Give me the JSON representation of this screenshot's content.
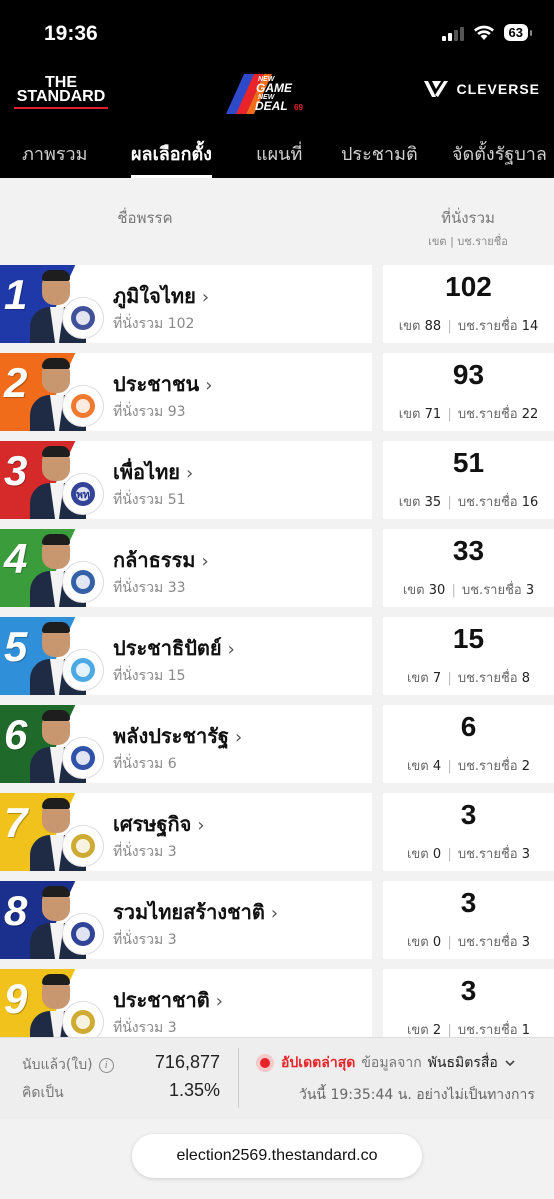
{
  "status_bar": {
    "time": "19:36",
    "battery": "63"
  },
  "header": {
    "logo_left": "THE STANDARD",
    "logo_game_lines": [
      "NEW",
      "GAME",
      "NEW",
      "DEAL",
      "69"
    ],
    "logo_right": "CLEVERSE"
  },
  "tabs": [
    {
      "label": "ภาพรวม",
      "active": false
    },
    {
      "label": "ผลเลือกตั้ง",
      "active": true
    },
    {
      "label": "แผนที่",
      "active": false
    },
    {
      "label": "ประชามติ",
      "active": false
    },
    {
      "label": "จัดตั้งรัฐบาล",
      "active": false
    }
  ],
  "columns": {
    "party": "ชื่อพรรค",
    "seats": "ที่นั่งรวม",
    "seats_sub": "เขต | บช.รายชื่อ"
  },
  "labels": {
    "total_prefix": "ที่นั่งรวม",
    "constituency": "เขต",
    "party_list": "บช.รายชื่อ"
  },
  "parties": [
    {
      "rank": "1",
      "name": "ภูมิใจไทย",
      "total": "102",
      "district": "88",
      "list": "14",
      "color": "#1f3aa8",
      "logo": "#2c3f8f",
      "logo_text": ""
    },
    {
      "rank": "2",
      "name": "ประชาชน",
      "total": "93",
      "district": "71",
      "list": "22",
      "color": "#f06c1b",
      "logo": "#f06c1b",
      "logo_text": ""
    },
    {
      "rank": "3",
      "name": "เพื่อไทย",
      "total": "51",
      "district": "35",
      "list": "16",
      "color": "#d62a2a",
      "logo": "#1d2f8c",
      "logo_text": "พท"
    },
    {
      "rank": "4",
      "name": "กล้าธรรม",
      "total": "33",
      "district": "30",
      "list": "3",
      "color": "#3a9c3a",
      "logo": "#1d4f9c",
      "logo_text": ""
    },
    {
      "rank": "5",
      "name": "ประชาธิปัตย์",
      "total": "15",
      "district": "7",
      "list": "8",
      "color": "#2f8fd8",
      "logo": "#3aa0e0",
      "logo_text": ""
    },
    {
      "rank": "6",
      "name": "พลังประชารัฐ",
      "total": "6",
      "district": "4",
      "list": "2",
      "color": "#1f6a2a",
      "logo": "#1b3fa0",
      "logo_text": ""
    },
    {
      "rank": "7",
      "name": "เศรษฐกิจ",
      "total": "3",
      "district": "0",
      "list": "3",
      "color": "#f0c21b",
      "logo": "#c9a21e",
      "logo_text": ""
    },
    {
      "rank": "8",
      "name": "รวมไทยสร้างชาติ",
      "total": "3",
      "district": "0",
      "list": "3",
      "color": "#1b2f8c",
      "logo": "#1b2f8c",
      "logo_text": ""
    },
    {
      "rank": "9",
      "name": "ประชาชาติ",
      "total": "3",
      "district": "2",
      "list": "1",
      "color": "#f0c21b",
      "logo": "#caa21e",
      "logo_text": ""
    }
  ],
  "summary": {
    "counted_label": "นับแล้ว(ใบ)",
    "counted_value": "716,877",
    "percent_label": "คิดเป็น",
    "percent_value": "1.35%",
    "update_label": "อัปเดตล่าสุด",
    "source_label": "ข้อมูลจาก",
    "source_name": "พันธมิตรสื่อ",
    "timestamp": "วันนี้ 19:35:44 น. อย่างไม่เป็นทางการ"
  },
  "url": "election2569.thestandard.co"
}
